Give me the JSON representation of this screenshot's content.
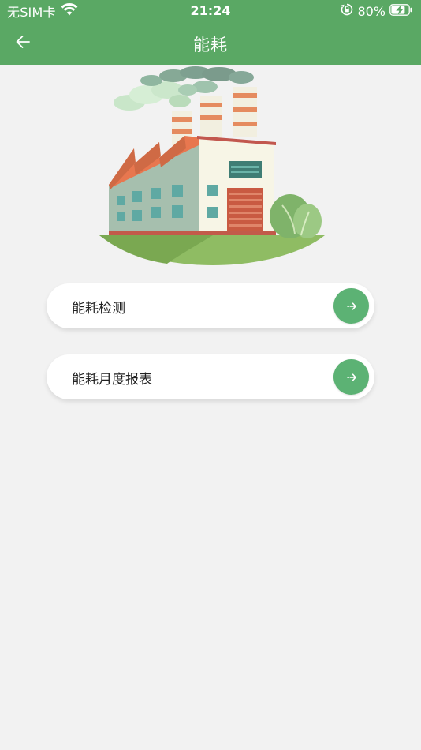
{
  "status_bar": {
    "carrier": "无SIM卡",
    "time": "21:24",
    "battery_percent": "80%",
    "battery_level": 0.8,
    "icons": [
      "wifi-icon",
      "orientation-lock-icon",
      "battery-charging-icon"
    ]
  },
  "nav": {
    "title": "能耗",
    "back_icon": "arrow-left-icon"
  },
  "illustration": {
    "subject": "factory-illustration"
  },
  "menu": {
    "items": [
      {
        "label": "能耗检测",
        "icon": "arrow-right-icon"
      },
      {
        "label": "能耗月度报表",
        "icon": "arrow-right-icon"
      }
    ]
  },
  "colors": {
    "header": "#5aa864",
    "accent": "#5cb274",
    "background": "#f2f2f2"
  }
}
